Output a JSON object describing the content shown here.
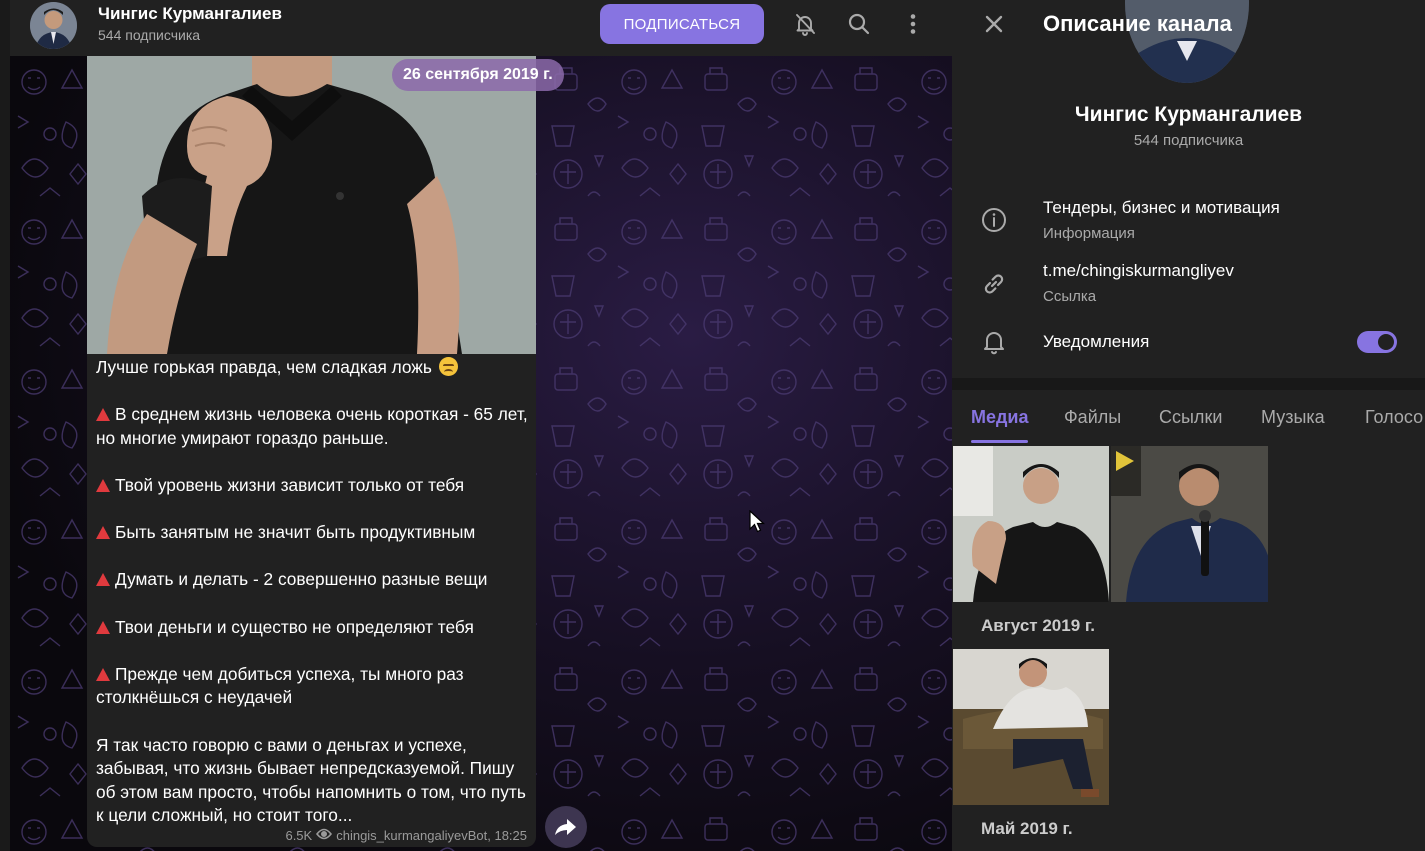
{
  "colors": {
    "accent": "#8774e1",
    "chat_bg": "#0d0b10",
    "panel_bg": "#212121",
    "bullet_triangle": "#e03a3e",
    "date_pill": "#8c6aaa"
  },
  "header": {
    "title": "Чингис Курмангалиев",
    "subtitle": "544 подписчика",
    "subscribe_label": "ПОДПИСАТЬСЯ",
    "icons": [
      "mute-bell-icon",
      "search-icon",
      "more-vertical-icon"
    ]
  },
  "chat": {
    "date_pill": "26 сентября 2019 г.",
    "message": {
      "intro": "Лучше горькая правда, чем сладкая ложь",
      "bullets": [
        "В среднем жизнь человека очень короткая - 65 лет, но многие умирают гораздо раньше.",
        "Твой уровень жизни зависит только от тебя",
        "Быть занятым не значит быть продуктивным",
        "Думать и делать - 2 совершенно разные вещи",
        "Твои деньги и существо не определяют тебя",
        "Прежде чем добиться успеха, ты много раз столкнёшься с неудачей"
      ],
      "closing": "Я так часто говорю с вами о деньгах и успехе, забывая, что жизнь бывает непредсказуемой. Пишу об этом вам просто, чтобы напомнить о том, что путь к цели сложный, но стоит того...",
      "views": "6.5K",
      "via": "chingis_kurmangaliyevBot, 18:25"
    }
  },
  "panel": {
    "title": "Описание канала",
    "name": "Чингис Курмангалиев",
    "subscribers": "544 подписчика",
    "info": {
      "description": "Тендеры, бизнес и мотивация",
      "description_label": "Информация",
      "link": "t.me/chingiskurmangliyev",
      "link_label": "Ссылка",
      "notifications_label": "Уведомления",
      "notifications_on": true
    },
    "tabs": [
      "Медиа",
      "Файлы",
      "Ссылки",
      "Музыка",
      "Голосо"
    ],
    "media_groups": [
      {
        "month": "Август 2019 г."
      },
      {
        "month": "Май 2019 г."
      }
    ]
  }
}
